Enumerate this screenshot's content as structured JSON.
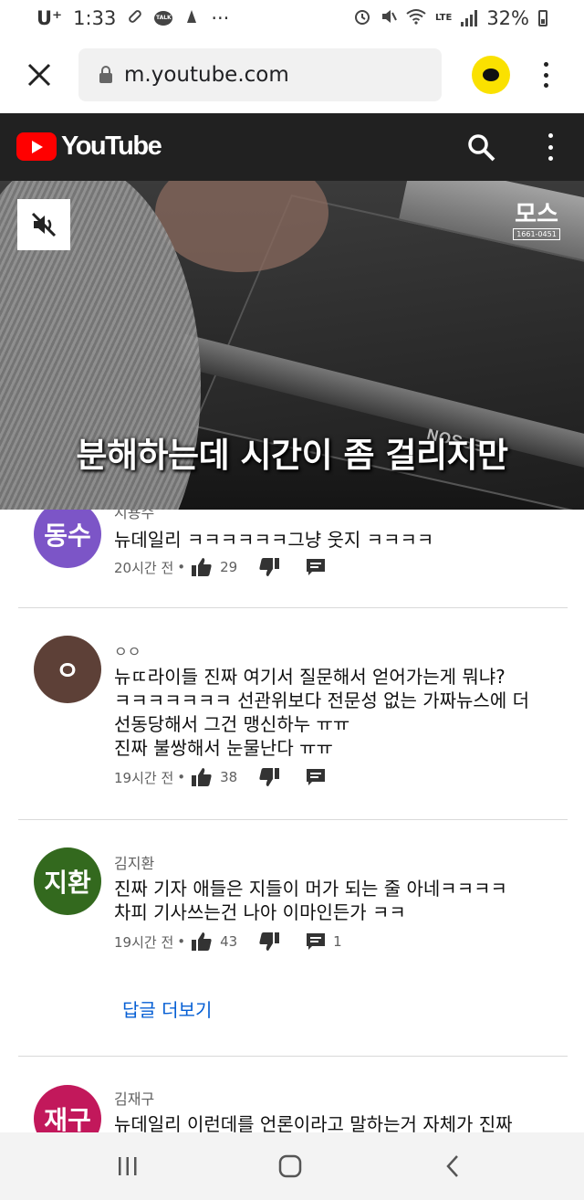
{
  "status_bar": {
    "carrier": "U⁺",
    "time": "1:33",
    "notif_talk": "TALK",
    "more": "···",
    "network": "LTE",
    "battery": "32%"
  },
  "browser": {
    "url": "m.youtube.com"
  },
  "youtube": {
    "logo_text": "YouTube"
  },
  "video": {
    "subtitle": "분해하는데 시간이 좀 걸리지만",
    "brand_print": "EPSON",
    "channel_big": "모스",
    "channel_small": "1661-0451"
  },
  "comments": [
    {
      "author": "지용수",
      "avatar_text": "동수",
      "avatar_color": "#7c55c7",
      "text": "뉴데일리 ㅋㅋㅋㅋㅋㅋ그냥 웃지 ㅋㅋㅋㅋ",
      "time": "20시간 전",
      "likes": "29",
      "replies": ""
    },
    {
      "author": "ㅇㅇ",
      "avatar_text": "ㅇ",
      "avatar_color": "#5d4037",
      "text": "뉴ㄸ라이들 진짜 여기서 질문해서 얻어가는게 뭐냐?\nㅋㅋㅋㅋㅋㅋㅋ 선관위보다 전문성 없는 가짜뉴스에 더\n선동당해서 그건 맹신하누 ㅠㅠ\n진짜 불쌍해서 눈물난다 ㅠㅠ",
      "time": "19시간 전",
      "likes": "38",
      "replies": ""
    },
    {
      "author": "김지환",
      "avatar_text": "지환",
      "avatar_color": "#33691e",
      "text": "진짜 기자 애들은 지들이 머가 되는 줄 아네ㅋㅋㅋㅋ\n차피 기사쓰는건 나아 이마인든가 ㅋㅋ",
      "time": "19시간 전",
      "likes": "43",
      "replies": "1"
    },
    {
      "author": "김재구",
      "avatar_text": "재구",
      "avatar_color": "#c2185b",
      "text": "뉴데일리 이런데를 언론이라고 말하는거 자체가 진짜",
      "time": "",
      "likes": "",
      "replies": ""
    }
  ],
  "more_replies_label": "답글 더보기",
  "meta_separator": "•",
  "colors": {
    "youtube_red": "#ff0000",
    "header_dark": "#212121",
    "link_blue": "#065fd4",
    "kakao_yellow": "#fae100"
  },
  "icons": [
    "close-icon",
    "lock-icon",
    "kakao-icon",
    "more-vert-icon",
    "youtube-logo-icon",
    "search-icon",
    "mute-icon",
    "thumb-up-icon",
    "thumb-down-icon",
    "reply-icon",
    "recents-icon",
    "home-icon",
    "back-icon"
  ]
}
